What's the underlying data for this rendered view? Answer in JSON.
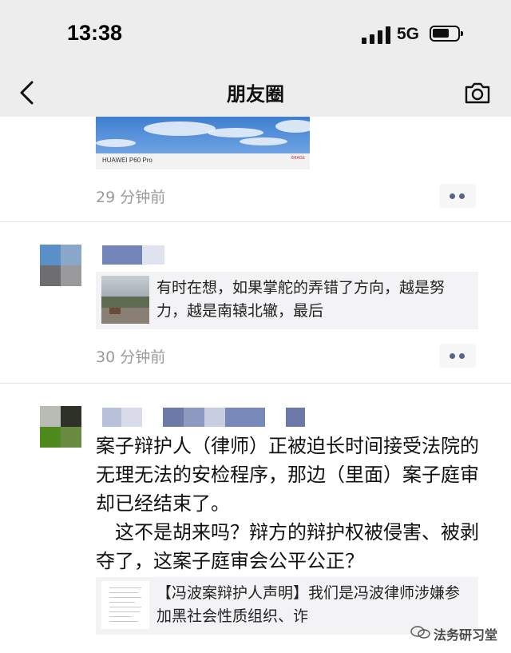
{
  "status_bar": {
    "time": "13:38",
    "network": "5G"
  },
  "nav": {
    "title": "朋友圈"
  },
  "post1": {
    "image_brand": "HUAWEI P60 Pro",
    "image_brand_right": "XMAGE",
    "time": "29 分钟前"
  },
  "post2": {
    "share_text": "有时在想，如果掌舵的弄错了方向，越是努力，越是南辕北辙，最后",
    "time": "30 分钟前"
  },
  "post3": {
    "paragraphs": [
      "案子辩护人（律师）正被迫长时间接受法院的无理无法的安检程序，那边（里面）案子庭审却已经结束了。",
      "　这不是胡来吗？辩方的辩护权被侵害、被剥夺了，这案子庭审会公平公正？"
    ],
    "share_text": "【冯波案辩护人声明】我们是冯波律师涉嫌参加黑社会性质组织、诈"
  },
  "watermark": "法务研习堂",
  "icons": {
    "back": "chevron-left-icon",
    "camera": "camera-icon",
    "more": "more-dots-icon",
    "signal": "signal-icon",
    "battery": "battery-icon"
  },
  "colors": {
    "header_bg": "#ededed",
    "time_text": "#9a9a9a",
    "more_dots": "#56648c",
    "card_bg": "#f3f3f5"
  }
}
